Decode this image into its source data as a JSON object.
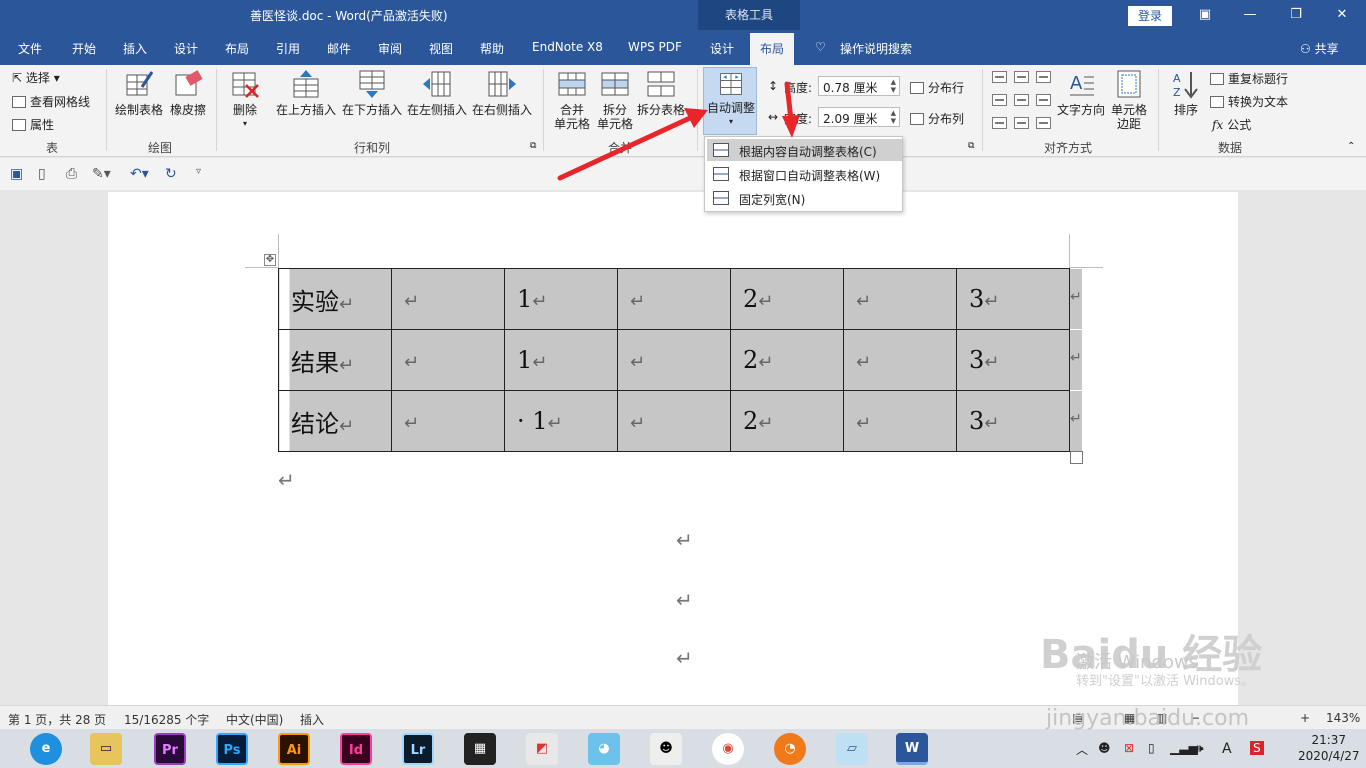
{
  "titlebar": {
    "title": "善医怪谈.doc  -  Word(产品激活失败)",
    "context_tab": "表格工具",
    "login": "登录",
    "icons": [
      "ribbon-display-icon",
      "minimize-icon",
      "restore-icon",
      "close-icon"
    ]
  },
  "tabs": [
    "文件",
    "开始",
    "插入",
    "设计",
    "布局",
    "引用",
    "邮件",
    "审阅",
    "视图",
    "帮助",
    "EndNote X8",
    "WPS PDF",
    "设计",
    "布局"
  ],
  "tell_me": "操作说明搜索",
  "share": "共享",
  "ribbon": {
    "table_group": {
      "label": "表",
      "select": "选择",
      "gridlines": "查看网格线",
      "properties": "属性"
    },
    "draw_group": {
      "label": "绘图",
      "draw_table": "绘制表格",
      "eraser": "橡皮擦"
    },
    "rows_cols_group": {
      "label": "行和列",
      "delete": "删除",
      "insert_above": "在上方插入",
      "insert_below": "在下方插入",
      "insert_left": "在左侧插入",
      "insert_right": "在右侧插入"
    },
    "merge_group": {
      "label": "合并",
      "merge_cells_1": "合并",
      "merge_cells_2": "单元格",
      "split_cells_1": "拆分",
      "split_cells_2": "单元格",
      "split_table": "拆分表格"
    },
    "cell_size_group": {
      "autofit": "自动调整",
      "height_label": "高度:",
      "height_value": "0.78 厘米",
      "width_label": "宽度:",
      "width_value": "2.09 厘米",
      "distribute_rows": "分布行",
      "distribute_cols": "分布列"
    },
    "alignment_group": {
      "label": "对齐方式",
      "text_direction": "文字方向",
      "cell_margins_1": "单元格",
      "cell_margins_2": "边距"
    },
    "data_group": {
      "label": "数据",
      "sort": "排序",
      "repeat_header": "重复标题行",
      "convert_to_text": "转换为文本",
      "formula": "公式"
    }
  },
  "autofit_menu": [
    {
      "label": "根据内容自动调整表格(C)",
      "highlighted": true
    },
    {
      "label": "根据窗口自动调整表格(W)",
      "highlighted": false
    },
    {
      "label": "固定列宽(N)",
      "highlighted": false
    }
  ],
  "table": {
    "rows": [
      [
        "实验",
        "",
        "1",
        "",
        "2",
        "",
        "3"
      ],
      [
        "结果",
        "",
        "1",
        "",
        "2",
        "",
        "3"
      ],
      [
        "结论",
        "",
        "· 1",
        "",
        "2",
        "",
        "3"
      ]
    ],
    "paragraph_mark": "↵"
  },
  "watermark": {
    "line1": "激活 Windows",
    "line2": "转到\"设置\"以激活 Windows。",
    "brand": "Baidu 经验",
    "url": "jingyan.baidu.com"
  },
  "statusbar": {
    "page": "第 1 页，共 28 页",
    "words": "15/16285 个字",
    "language": "中文(中国)",
    "mode": "插入",
    "zoom": "143%"
  },
  "taskbar": {
    "apps": [
      "Pr",
      "Ps",
      "Ai",
      "Id",
      "Lr"
    ],
    "ime": "A",
    "time": "21:37",
    "date": "2020/4/27"
  },
  "colors": {
    "word_blue": "#2b579a",
    "selection_gray": "#c6c6c6",
    "arrow_red": "#e8262a"
  }
}
